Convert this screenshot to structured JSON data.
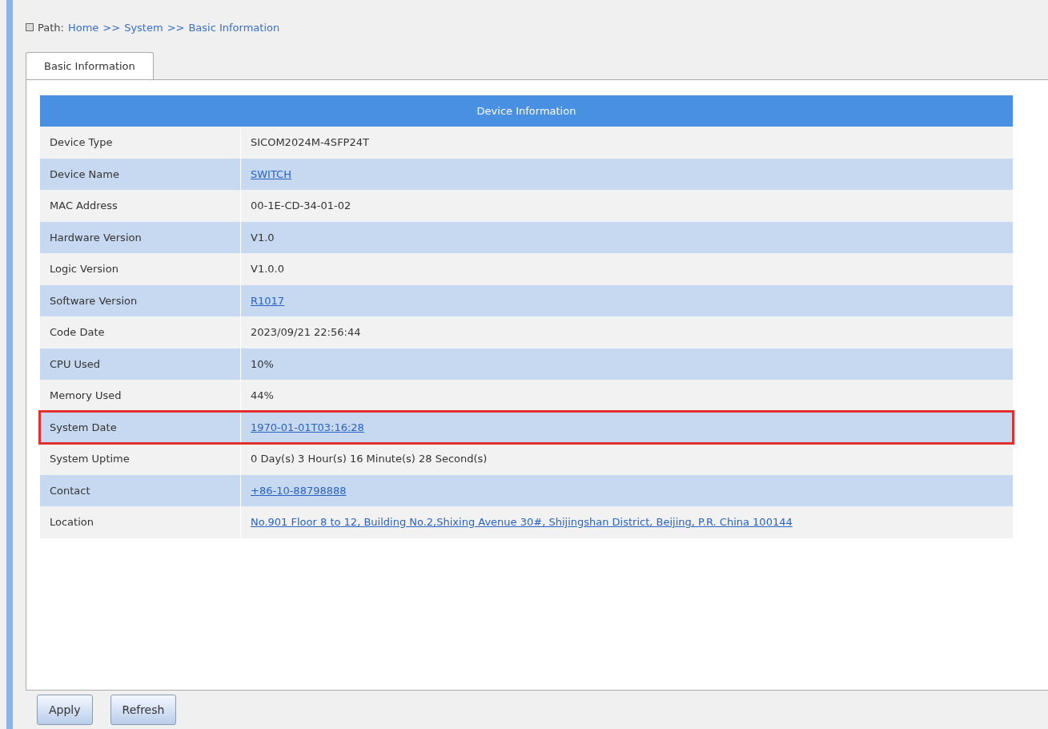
{
  "path": {
    "label": "Path:",
    "crumbs": [
      "Home",
      ">>",
      "System",
      ">>",
      "Basic Information"
    ]
  },
  "tabs": [
    {
      "label": "Basic Information",
      "selected": true
    }
  ],
  "table": {
    "title": "Device Information",
    "rows": [
      {
        "label": "Device Type",
        "value": "SICOM2024M-4SFP24T",
        "link": false,
        "highlighted": false
      },
      {
        "label": "Device Name",
        "value": "SWITCH",
        "link": true,
        "highlighted": false
      },
      {
        "label": "MAC Address",
        "value": "00-1E-CD-34-01-02",
        "link": false,
        "highlighted": false
      },
      {
        "label": "Hardware Version",
        "value": "V1.0",
        "link": false,
        "highlighted": false
      },
      {
        "label": "Logic Version",
        "value": "V1.0.0",
        "link": false,
        "highlighted": false
      },
      {
        "label": "Software Version",
        "value": "R1017",
        "link": true,
        "highlighted": false
      },
      {
        "label": "Code Date",
        "value": "2023/09/21 22:56:44",
        "link": false,
        "highlighted": false
      },
      {
        "label": "CPU Used",
        "value": "10%",
        "link": false,
        "highlighted": false
      },
      {
        "label": "Memory Used",
        "value": "44%",
        "link": false,
        "highlighted": false
      },
      {
        "label": "System Date",
        "value": "1970-01-01T03:16:28",
        "link": true,
        "highlighted": true
      },
      {
        "label": "System Uptime",
        "value": "0 Day(s) 3 Hour(s) 16 Minute(s) 28 Second(s)",
        "link": false,
        "highlighted": false
      },
      {
        "label": "Contact",
        "value": "+86-10-88798888",
        "link": true,
        "highlighted": false
      },
      {
        "label": "Location",
        "value": "No.901 Floor 8 to 12, Building No.2,Shixing Avenue 30#, Shijingshan District, Beijing, P.R. China 100144",
        "link": true,
        "highlighted": false
      }
    ]
  },
  "buttons": [
    "Apply",
    "Refresh"
  ]
}
